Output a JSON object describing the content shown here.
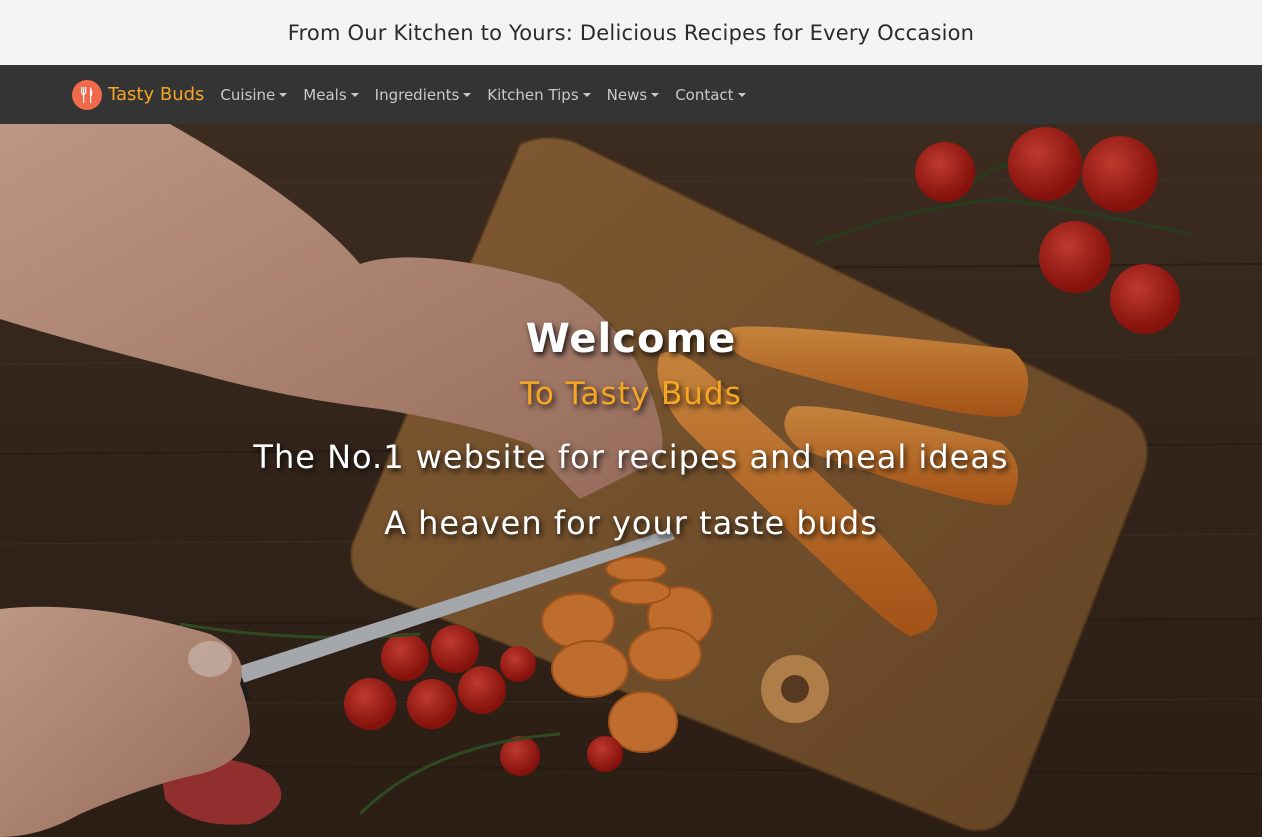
{
  "banner": {
    "text": "From Our Kitchen to Yours: Delicious Recipes for Every Occasion"
  },
  "navbar": {
    "brand": "Tasty Buds",
    "items": [
      {
        "label": "Cuisine"
      },
      {
        "label": "Meals"
      },
      {
        "label": "Ingredients"
      },
      {
        "label": "Kitchen Tips"
      },
      {
        "label": "News"
      },
      {
        "label": "Contact"
      }
    ]
  },
  "hero": {
    "welcome": "Welcome",
    "subtitle": "To Tasty Buds",
    "tagline1": "The No.1 website for recipes and meal ideas",
    "tagline2": "A heaven for your taste buds",
    "background_icon": "cutting-board-carrots-tomatoes-image"
  },
  "colors": {
    "brand_accent": "#f5a623",
    "logo_bg": "#f0694b",
    "navbar_bg": "#343434",
    "banner_bg": "#f4f4f4"
  }
}
